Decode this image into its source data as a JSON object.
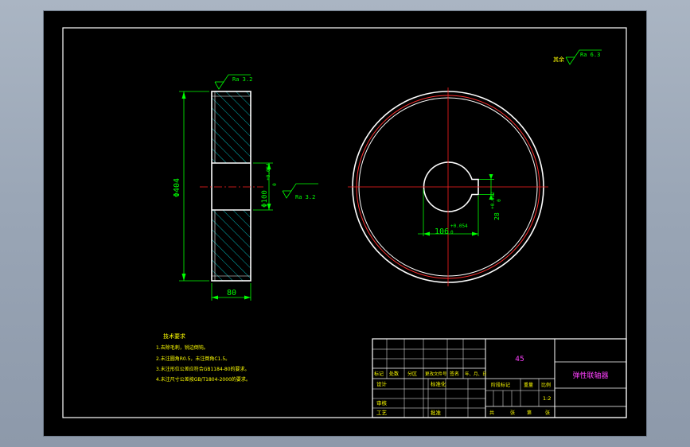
{
  "drawing": {
    "roughness_top_side": "Ra 3.2",
    "roughness_bore_side": "Ra 3.2",
    "roughness_remaining_label": "其余",
    "roughness_remaining_value": "Ra 6.3",
    "dim_outer_diameter": "Φ404",
    "dim_bore_diameter": "Φ100",
    "dim_bore_tol_upper": "+0.054",
    "dim_bore_tol_lower": "0",
    "dim_width": "80",
    "dim_keyway_depth": "106",
    "dim_keyway_tol_upper": "+0.054",
    "dim_keyway_tol_lower": "0",
    "dim_key_width": "28",
    "dim_key_tol_upper": "+0.052",
    "dim_key_tol_lower": "0"
  },
  "notes": {
    "title": "技术要求",
    "lines": [
      "1.去除毛刺，锐边倒钝。",
      "2.未注圆角R0.5，未注倒角C1.5。",
      "3.未注形位公差应符合GB1184-80的要求。",
      "4.未注尺寸公差按GB/T1804-2000的要求。"
    ]
  },
  "title_block": {
    "material": "45",
    "part_name": "弹性联轴器",
    "headers": [
      "标记",
      "处数",
      "分区",
      "更改文件号",
      "签名",
      "年、月、日"
    ],
    "design": "设计",
    "standardize": "标准化",
    "review": "审核",
    "process": "工艺",
    "approve": "批准",
    "stage_mark": "阶段标记",
    "weight": "重量",
    "scale_label": "比例",
    "scale_value": "1:2",
    "sheets": [
      "共",
      "张",
      "第",
      "张"
    ]
  }
}
